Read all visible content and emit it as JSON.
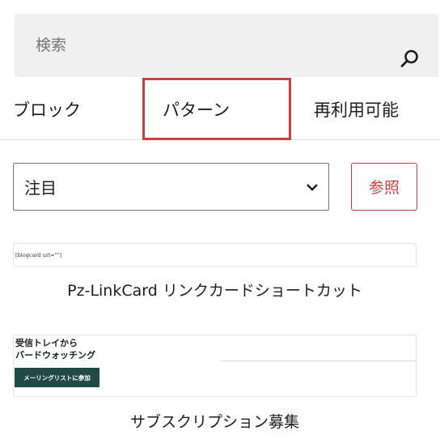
{
  "search": {
    "placeholder": "検索",
    "icon": "search-icon"
  },
  "tabs": [
    {
      "label": "ブロック",
      "selected": false
    },
    {
      "label": "パターン",
      "selected": true
    },
    {
      "label": "再利用可能",
      "selected": false
    }
  ],
  "category": {
    "selected": "注目",
    "icon": "chevron-down-icon"
  },
  "explore_button": {
    "label": "参照"
  },
  "patterns": [
    {
      "title": "Pz-LinkCard リンクカードショートカット",
      "preview": {
        "code": "[blogcard url=\"\"]"
      }
    },
    {
      "title": "サブスクリプション募集",
      "preview": {
        "heading_line1": "受信トレイから",
        "heading_line2": "バードウォッチング",
        "button": "メーリングリストに参加"
      }
    }
  ],
  "colors": {
    "accent": "#cc3f3f",
    "panel": "#f0f0f0",
    "preview_button": "#214a45"
  }
}
